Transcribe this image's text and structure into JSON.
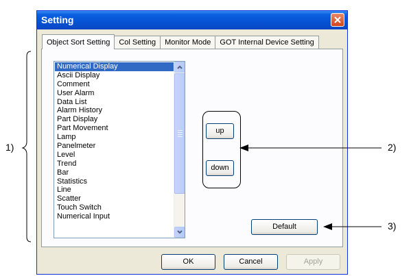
{
  "window": {
    "title": "Setting"
  },
  "tabs": [
    {
      "label": "Object Sort Setting",
      "active": true
    },
    {
      "label": "Col Setting",
      "active": false
    },
    {
      "label": "Monitor Mode",
      "active": false
    },
    {
      "label": "GOT Internal Device Setting",
      "active": false
    }
  ],
  "list": {
    "items": [
      "Numerical Display",
      "Ascii Display",
      "Comment",
      "User Alarm",
      "Data List",
      "Alarm History",
      "Part Display",
      "Part Movement",
      "Lamp",
      "Panelmeter",
      "Level",
      "Trend",
      "Bar",
      "Statistics",
      "Line",
      "Scatter",
      "Touch Switch",
      "Numerical Input"
    ],
    "selected_index": 0
  },
  "buttons": {
    "up": "up",
    "down": "down",
    "default": "Default",
    "ok": "OK",
    "cancel": "Cancel",
    "apply": "Apply"
  },
  "callouts": {
    "one": "1)",
    "two": "2)",
    "three": "3)"
  },
  "colors": {
    "title_bar": "#0553d4",
    "selection": "#316ac5",
    "dialog_bg": "#ece9d8"
  }
}
